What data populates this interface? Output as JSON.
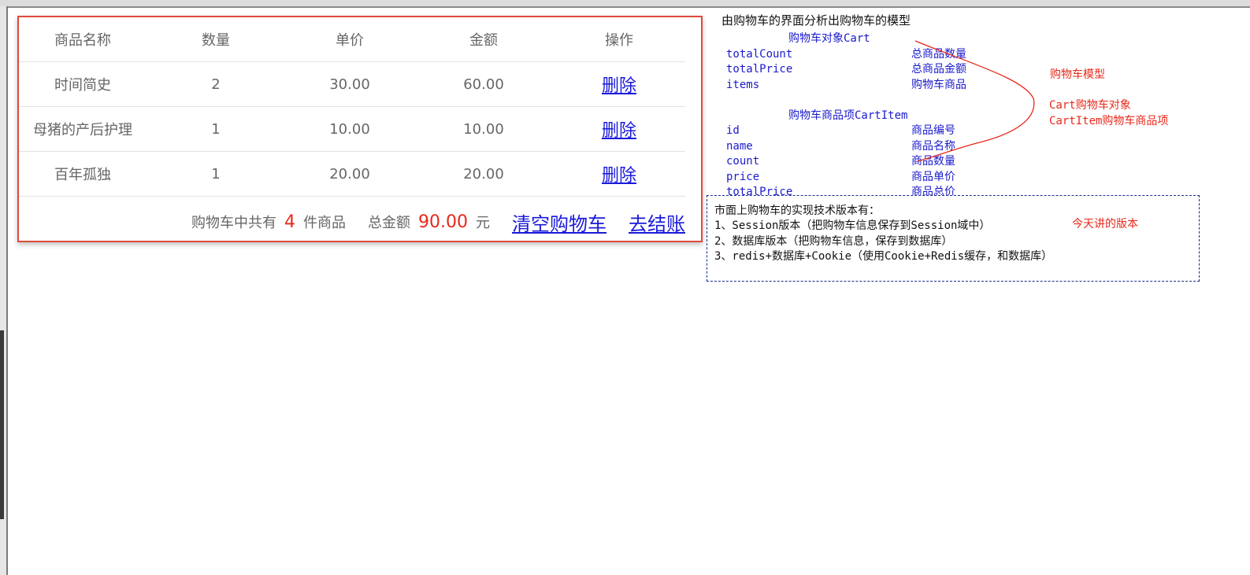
{
  "cart": {
    "headers": [
      "商品名称",
      "数量",
      "单价",
      "金额",
      "操作"
    ],
    "rows": [
      {
        "name": "时间简史",
        "count": "2",
        "price": "30.00",
        "total": "60.00",
        "action": "删除"
      },
      {
        "name": "母猪的产后护理",
        "count": "1",
        "price": "10.00",
        "total": "10.00",
        "action": "删除"
      },
      {
        "name": "百年孤独",
        "count": "1",
        "price": "20.00",
        "total": "20.00",
        "action": "删除"
      }
    ],
    "summary": {
      "count_prefix": "购物车中共有",
      "count": "4",
      "count_suffix": "件商品",
      "amount_prefix": "总金额",
      "amount": "90.00",
      "amount_suffix": "元",
      "clear_label": "清空购物车",
      "checkout_label": "去结账"
    }
  },
  "notes": {
    "heading": "由购物车的界面分析出购物车的模型",
    "cart_title": "购物车对象Cart",
    "cart_fields": [
      {
        "field": "totalCount",
        "desc": "总商品数量"
      },
      {
        "field": "totalPrice",
        "desc": "总商品金额"
      },
      {
        "field": "items",
        "desc": "购物车商品"
      }
    ],
    "item_title": "购物车商品项CartItem",
    "item_fields": [
      {
        "field": "id",
        "desc": "商品编号"
      },
      {
        "field": "name",
        "desc": "商品名称"
      },
      {
        "field": "count",
        "desc": "商品数量"
      },
      {
        "field": "price",
        "desc": "商品单价"
      },
      {
        "field": "totalPrice",
        "desc": "商品总价"
      }
    ],
    "model_label": "购物车模型",
    "model_cart": "Cart购物车对象",
    "model_item": "CartItem购物车商品项",
    "tech_heading": "市面上购物车的实现技术版本有：",
    "tech_items": [
      "1、Session版本（把购物车信息保存到Session域中）",
      "2、数据库版本（把购物车信息，保存到数据库）",
      "3、redis+数据库+Cookie（使用Cookie+Redis缓存，和数据库）"
    ],
    "tech_highlight": "今天讲的版本"
  },
  "colors": {
    "accent_border": "#e0493c",
    "link": "#1a1adb",
    "highlight": "#e8281a",
    "note_blue": "#1a1acc"
  }
}
